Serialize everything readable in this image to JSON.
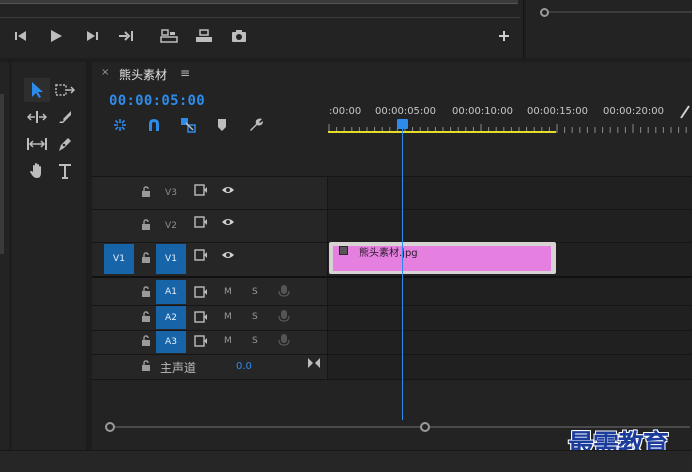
{
  "timeline": {
    "tab_close": "×",
    "tab_title": "熊头素材",
    "tab_menu": "≡",
    "timecode": "00:00:05:00",
    "ruler_labels": [
      ":00:00",
      "00:00:05:00",
      "00:00:10:00",
      "00:00:15:00",
      "00:00:20:00"
    ]
  },
  "tracks": {
    "video": [
      {
        "name": "V3",
        "source_target": "",
        "active": false
      },
      {
        "name": "V2",
        "source_target": "",
        "active": false
      },
      {
        "name": "V1",
        "source_target": "V1",
        "active": true
      }
    ],
    "audio": [
      {
        "name": "A1",
        "mute": "M",
        "solo": "S"
      },
      {
        "name": "A2",
        "mute": "M",
        "solo": "S"
      },
      {
        "name": "A3",
        "mute": "M",
        "solo": "S"
      }
    ],
    "master_label": "主声道",
    "master_value": "0.0"
  },
  "clip": {
    "name": "熊头素材.jpg",
    "color": "#e57fe0"
  },
  "playhead_position_seconds": 5,
  "watermark": "最需教育",
  "colors": {
    "accent": "#2d8ceb",
    "track_target": "#1764a8",
    "workarea": "#e4dc2a"
  }
}
